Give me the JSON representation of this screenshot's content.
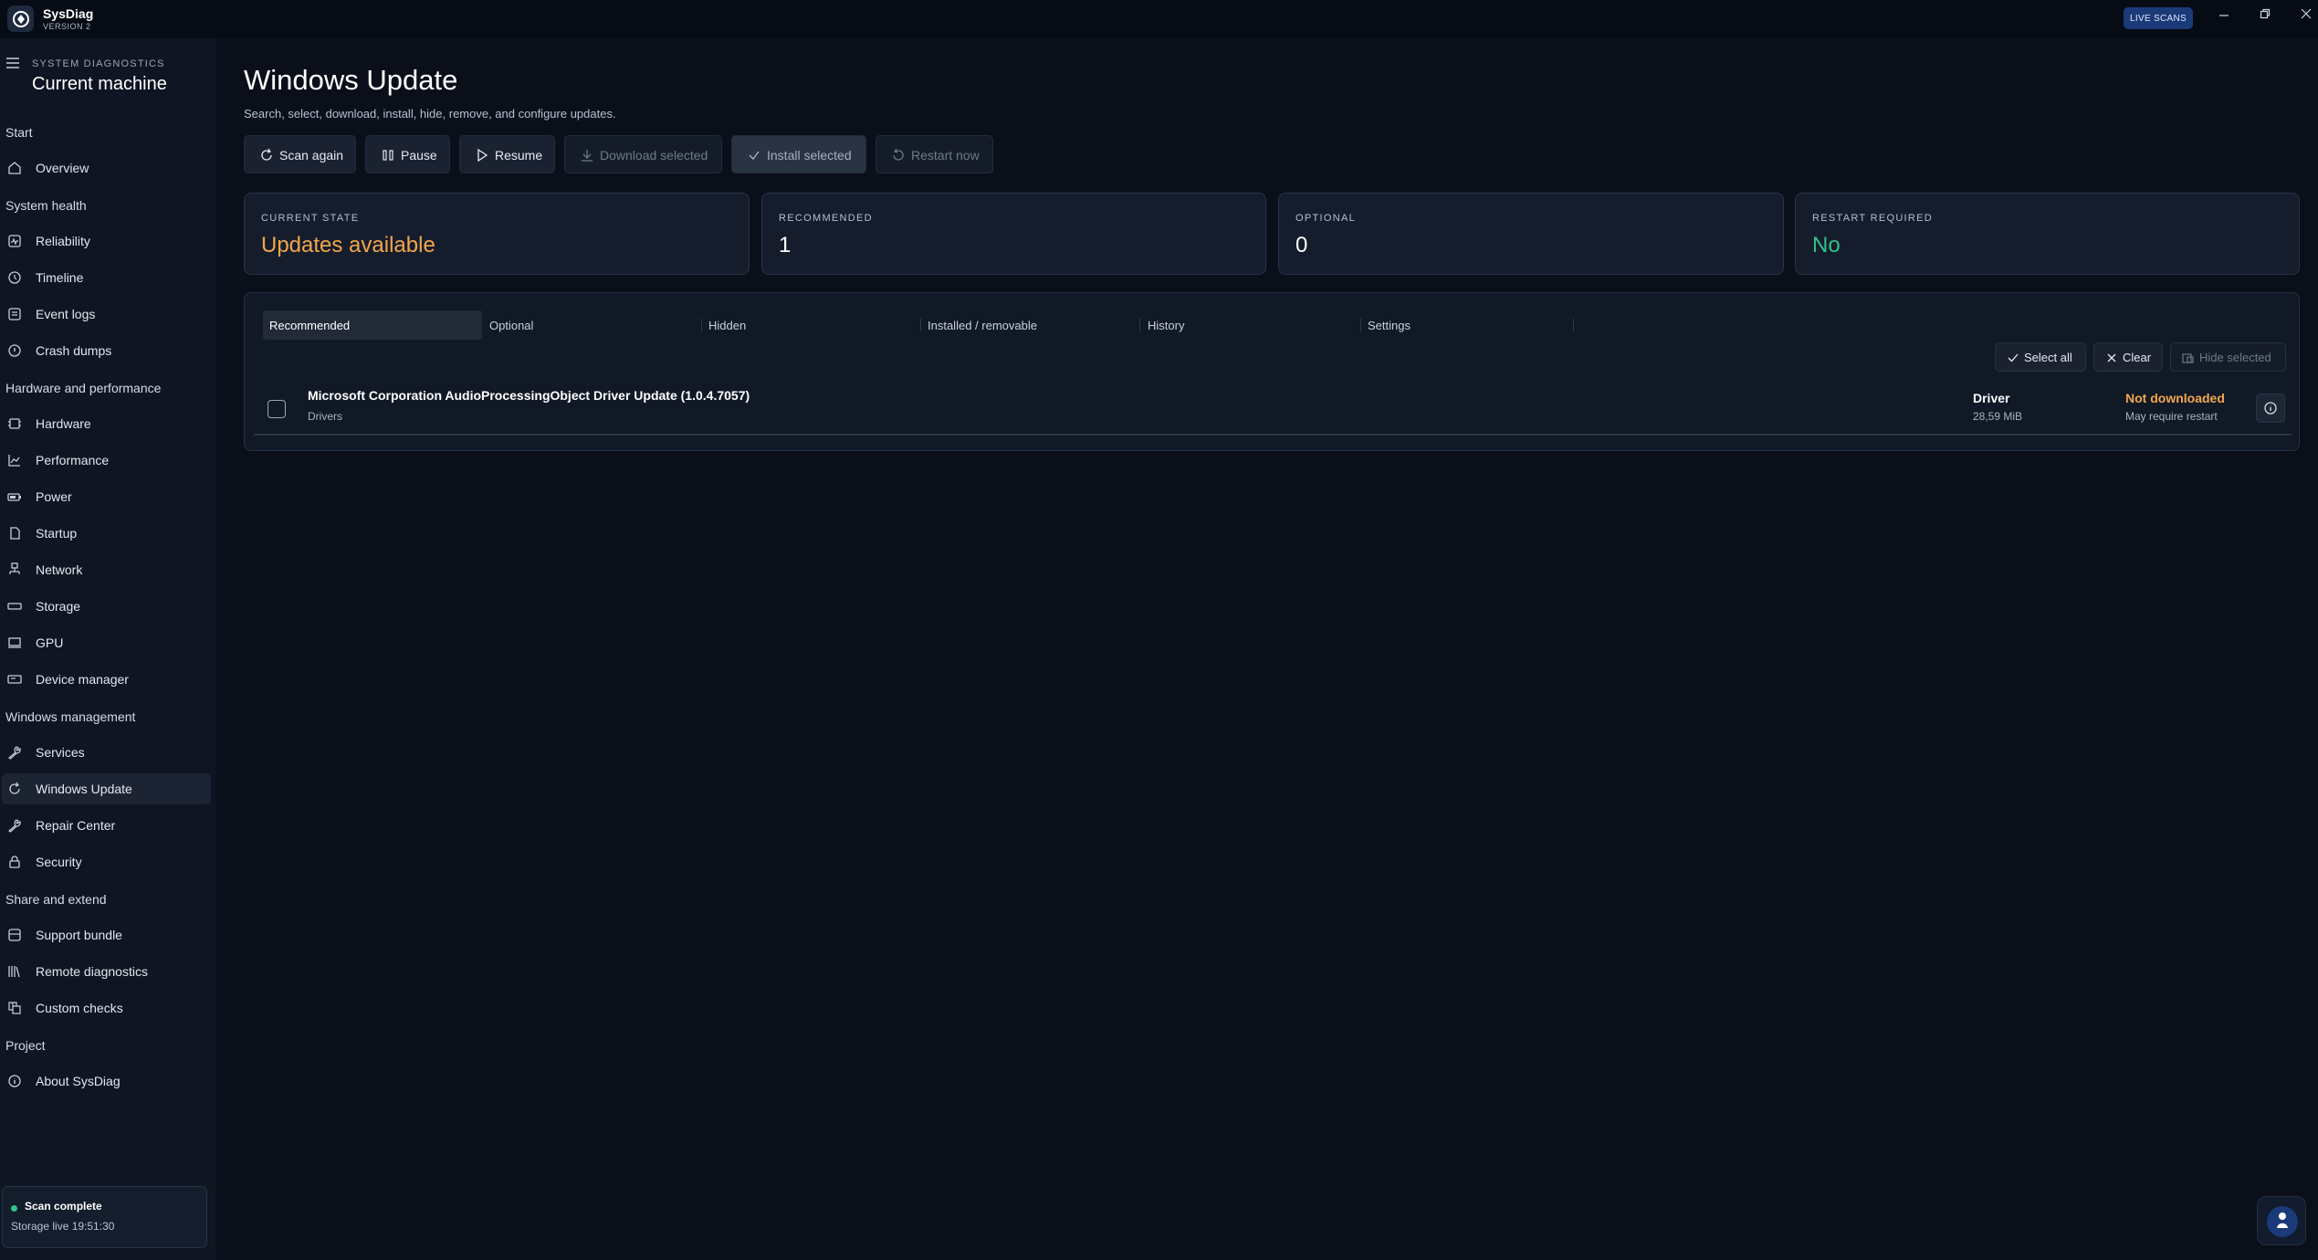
{
  "app": {
    "name": "SysDiag",
    "version": "VERSION 2",
    "live_badge": "LIVE SCANS"
  },
  "sidebar": {
    "overline": "SYSTEM DIAGNOSTICS",
    "title": "Current machine",
    "sections": [
      {
        "label": "Start",
        "items": [
          {
            "label": "Overview",
            "icon": "home-icon"
          }
        ]
      },
      {
        "label": "System health",
        "items": [
          {
            "label": "Reliability",
            "icon": "pulse-icon"
          },
          {
            "label": "Timeline",
            "icon": "history-icon"
          },
          {
            "label": "Event logs",
            "icon": "log-icon"
          },
          {
            "label": "Crash dumps",
            "icon": "alert-circle-icon"
          }
        ]
      },
      {
        "label": "Hardware and performance",
        "items": [
          {
            "label": "Hardware",
            "icon": "chip-icon"
          },
          {
            "label": "Performance",
            "icon": "chart-icon"
          },
          {
            "label": "Power",
            "icon": "battery-icon"
          },
          {
            "label": "Startup",
            "icon": "file-icon"
          },
          {
            "label": "Network",
            "icon": "network-icon"
          },
          {
            "label": "Storage",
            "icon": "drive-icon"
          },
          {
            "label": "GPU",
            "icon": "monitor-icon"
          },
          {
            "label": "Device manager",
            "icon": "device-icon"
          }
        ]
      },
      {
        "label": "Windows management",
        "items": [
          {
            "label": "Services",
            "icon": "wrench-icon"
          },
          {
            "label": "Windows Update",
            "icon": "refresh-icon",
            "active": true
          },
          {
            "label": "Repair Center",
            "icon": "wrench-icon"
          },
          {
            "label": "Security",
            "icon": "lock-icon"
          }
        ]
      },
      {
        "label": "Share and extend",
        "items": [
          {
            "label": "Support bundle",
            "icon": "package-icon"
          },
          {
            "label": "Remote diagnostics",
            "icon": "library-icon"
          },
          {
            "label": "Custom checks",
            "icon": "grid-icon"
          }
        ]
      },
      {
        "label": "Project",
        "items": [
          {
            "label": "About SysDiag",
            "icon": "info-icon"
          }
        ]
      }
    ],
    "status": {
      "title": "Scan complete",
      "detail": "Storage live 19:51:30",
      "color": "#2fc28a"
    }
  },
  "page": {
    "title": "Windows Update",
    "subtitle": "Search, select, download, install, hide, remove, and configure updates."
  },
  "toolbar": [
    {
      "label": "Scan again",
      "icon": "refresh-icon",
      "state": "enabled"
    },
    {
      "label": "Pause",
      "icon": "pause-icon",
      "state": "enabled"
    },
    {
      "label": "Resume",
      "icon": "play-icon",
      "state": "enabled"
    },
    {
      "label": "Download selected",
      "icon": "download-icon",
      "state": "disabled"
    },
    {
      "label": "Install selected",
      "icon": "check-icon",
      "state": "primary-disabled"
    },
    {
      "label": "Restart now",
      "icon": "restart-icon",
      "state": "disabled"
    }
  ],
  "cards": [
    {
      "caption": "CURRENT STATE",
      "value": "Updates available",
      "color": "#f2a64b"
    },
    {
      "caption": "RECOMMENDED",
      "value": "1",
      "color": "#ffffff"
    },
    {
      "caption": "OPTIONAL",
      "value": "0",
      "color": "#ffffff"
    },
    {
      "caption": "RESTART REQUIRED",
      "value": "No",
      "color": "#2fc28a"
    }
  ],
  "tabs": [
    "Recommended",
    "Optional",
    "Hidden",
    "Installed / removable",
    "History",
    "Settings"
  ],
  "active_tab": "Recommended",
  "selection": {
    "select_all": "Select all",
    "clear": "Clear",
    "hide_selected": "Hide selected"
  },
  "updates": [
    {
      "title": "Microsoft Corporation AudioProcessingObject Driver Update (1.0.4.7057)",
      "category": "Drivers",
      "type": "Driver",
      "size": "28,59 MiB",
      "status": "Not downloaded",
      "note": "May require restart",
      "checked": false
    }
  ],
  "colors": {
    "accent_orange": "#f2a64b",
    "accent_green": "#2fc28a",
    "badge_blue": "#1a3a78"
  }
}
